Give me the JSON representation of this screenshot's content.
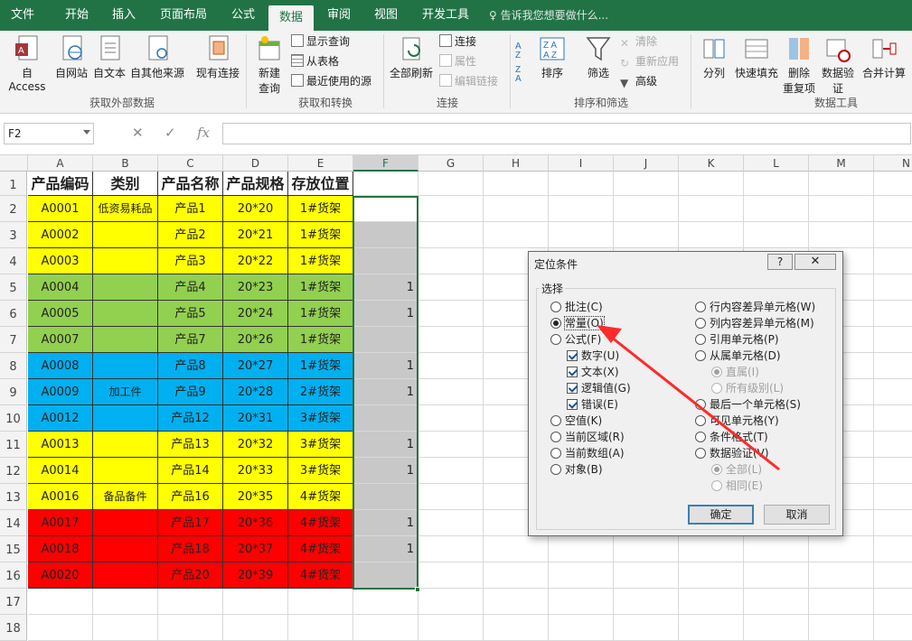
{
  "tabs": [
    "文件",
    "开始",
    "插入",
    "页面布局",
    "公式",
    "数据",
    "审阅",
    "视图",
    "开发工具"
  ],
  "active_tab": "数据",
  "tell_me": "告诉我您想要做什么...",
  "ribbon": {
    "get_external": {
      "label": "获取外部数据",
      "buttons": [
        "自 Access",
        "自网站",
        "自文本",
        "自其他来源",
        "现有连接"
      ]
    },
    "get_transform": {
      "label": "获取和转换",
      "new_query": "新建",
      "new_query2": "查询",
      "small": [
        "显示查询",
        "从表格",
        "最近使用的源"
      ]
    },
    "connections": {
      "label": "连接",
      "refresh_all": "全部刷新",
      "small": [
        "连接",
        "属性",
        "编辑链接"
      ]
    },
    "sort_filter": {
      "label": "排序和筛选",
      "sort": "排序",
      "filter": "筛选",
      "small": [
        "清除",
        "重新应用",
        "高级"
      ]
    },
    "data_tools": {
      "label": "数据工具",
      "buttons": [
        "分列",
        "快速填充",
        "删除",
        "重复项",
        "数据验",
        "证",
        "合并计算"
      ]
    }
  },
  "formula_bar": {
    "name_box": "F2",
    "fx": "fx",
    "formula": ""
  },
  "columns": [
    "A",
    "B",
    "C",
    "D",
    "E",
    "F",
    "G",
    "H",
    "I",
    "J",
    "K",
    "L",
    "M",
    "N"
  ],
  "selected_column": "F",
  "rows": [
    {
      "num": "1",
      "cells": [
        "产品编码",
        "类别",
        "产品名称",
        "产品规格",
        "存放位置",
        ""
      ]
    },
    {
      "num": "2",
      "cells": [
        "A0001",
        "低资易耗品",
        "产品1",
        "20*20",
        "1#货架",
        ""
      ]
    },
    {
      "num": "3",
      "cells": [
        "A0002",
        "",
        "产品2",
        "20*21",
        "1#货架",
        ""
      ]
    },
    {
      "num": "4",
      "cells": [
        "A0003",
        "",
        "产品3",
        "20*22",
        "1#货架",
        ""
      ]
    },
    {
      "num": "5",
      "cells": [
        "A0004",
        "",
        "产品4",
        "20*23",
        "1#货架",
        "1"
      ]
    },
    {
      "num": "6",
      "cells": [
        "A0005",
        "",
        "产品5",
        "20*24",
        "1#货架",
        "1"
      ]
    },
    {
      "num": "7",
      "cells": [
        "A0007",
        "",
        "产品7",
        "20*26",
        "1#货架",
        ""
      ]
    },
    {
      "num": "8",
      "cells": [
        "A0008",
        "",
        "产品8",
        "20*27",
        "1#货架",
        "1"
      ]
    },
    {
      "num": "9",
      "cells": [
        "A0009",
        "加工件",
        "产品9",
        "20*28",
        "2#货架",
        "1"
      ]
    },
    {
      "num": "10",
      "cells": [
        "A0012",
        "",
        "产品12",
        "20*31",
        "3#货架",
        ""
      ]
    },
    {
      "num": "11",
      "cells": [
        "A0013",
        "",
        "产品13",
        "20*32",
        "3#货架",
        "1"
      ]
    },
    {
      "num": "12",
      "cells": [
        "A0014",
        "",
        "产品14",
        "20*33",
        "3#货架",
        "1"
      ]
    },
    {
      "num": "13",
      "cells": [
        "A0016",
        "备品备件",
        "产品16",
        "20*35",
        "4#货架",
        ""
      ]
    },
    {
      "num": "14",
      "cells": [
        "A0017",
        "",
        "产品17",
        "20*36",
        "4#货架",
        "1"
      ]
    },
    {
      "num": "15",
      "cells": [
        "A0018",
        "",
        "产品18",
        "20*37",
        "4#货架",
        "1"
      ]
    },
    {
      "num": "16",
      "cells": [
        "A0020",
        "",
        "产品20",
        "20*39",
        "4#货架",
        ""
      ]
    },
    {
      "num": "17",
      "cells": [
        "",
        "",
        "",
        "",
        "",
        ""
      ]
    },
    {
      "num": "18",
      "cells": [
        "",
        "",
        "",
        "",
        "",
        ""
      ]
    }
  ],
  "row_colors": [
    "",
    "#ffff00",
    "#ffff00",
    "#ffff00",
    "#92d050",
    "#92d050",
    "#92d050",
    "#00b0f0",
    "#00b0f0",
    "#00b0f0",
    "#ffff00",
    "#ffff00",
    "#ffff00",
    "#ff0000",
    "#ff0000",
    "#ff0000",
    "",
    ""
  ],
  "dialog": {
    "title": "定位条件",
    "help": "?",
    "close": "✕",
    "group_label": "选择",
    "left_options": [
      "批注(C)",
      "常量(O)",
      "公式(F)",
      "数字(U)",
      "文本(X)",
      "逻辑值(G)",
      "错误(E)",
      "空值(K)",
      "当前区域(R)",
      "当前数组(A)",
      "对象(B)"
    ],
    "right_options": [
      "行内容差异单元格(W)",
      "列内容差异单元格(M)",
      "引用单元格(P)",
      "从属单元格(D)",
      "直属(I)",
      "所有级别(L)",
      "最后一个单元格(S)",
      "可见单元格(Y)",
      "条件格式(T)",
      "数据验证(V)",
      "全部(L)",
      "相同(E)"
    ],
    "ok": "确定",
    "cancel": "取消"
  },
  "colors": {
    "excel_green": "#217346",
    "arrow": "#ff2a2a",
    "selection_fill": "#c8c8c8"
  }
}
